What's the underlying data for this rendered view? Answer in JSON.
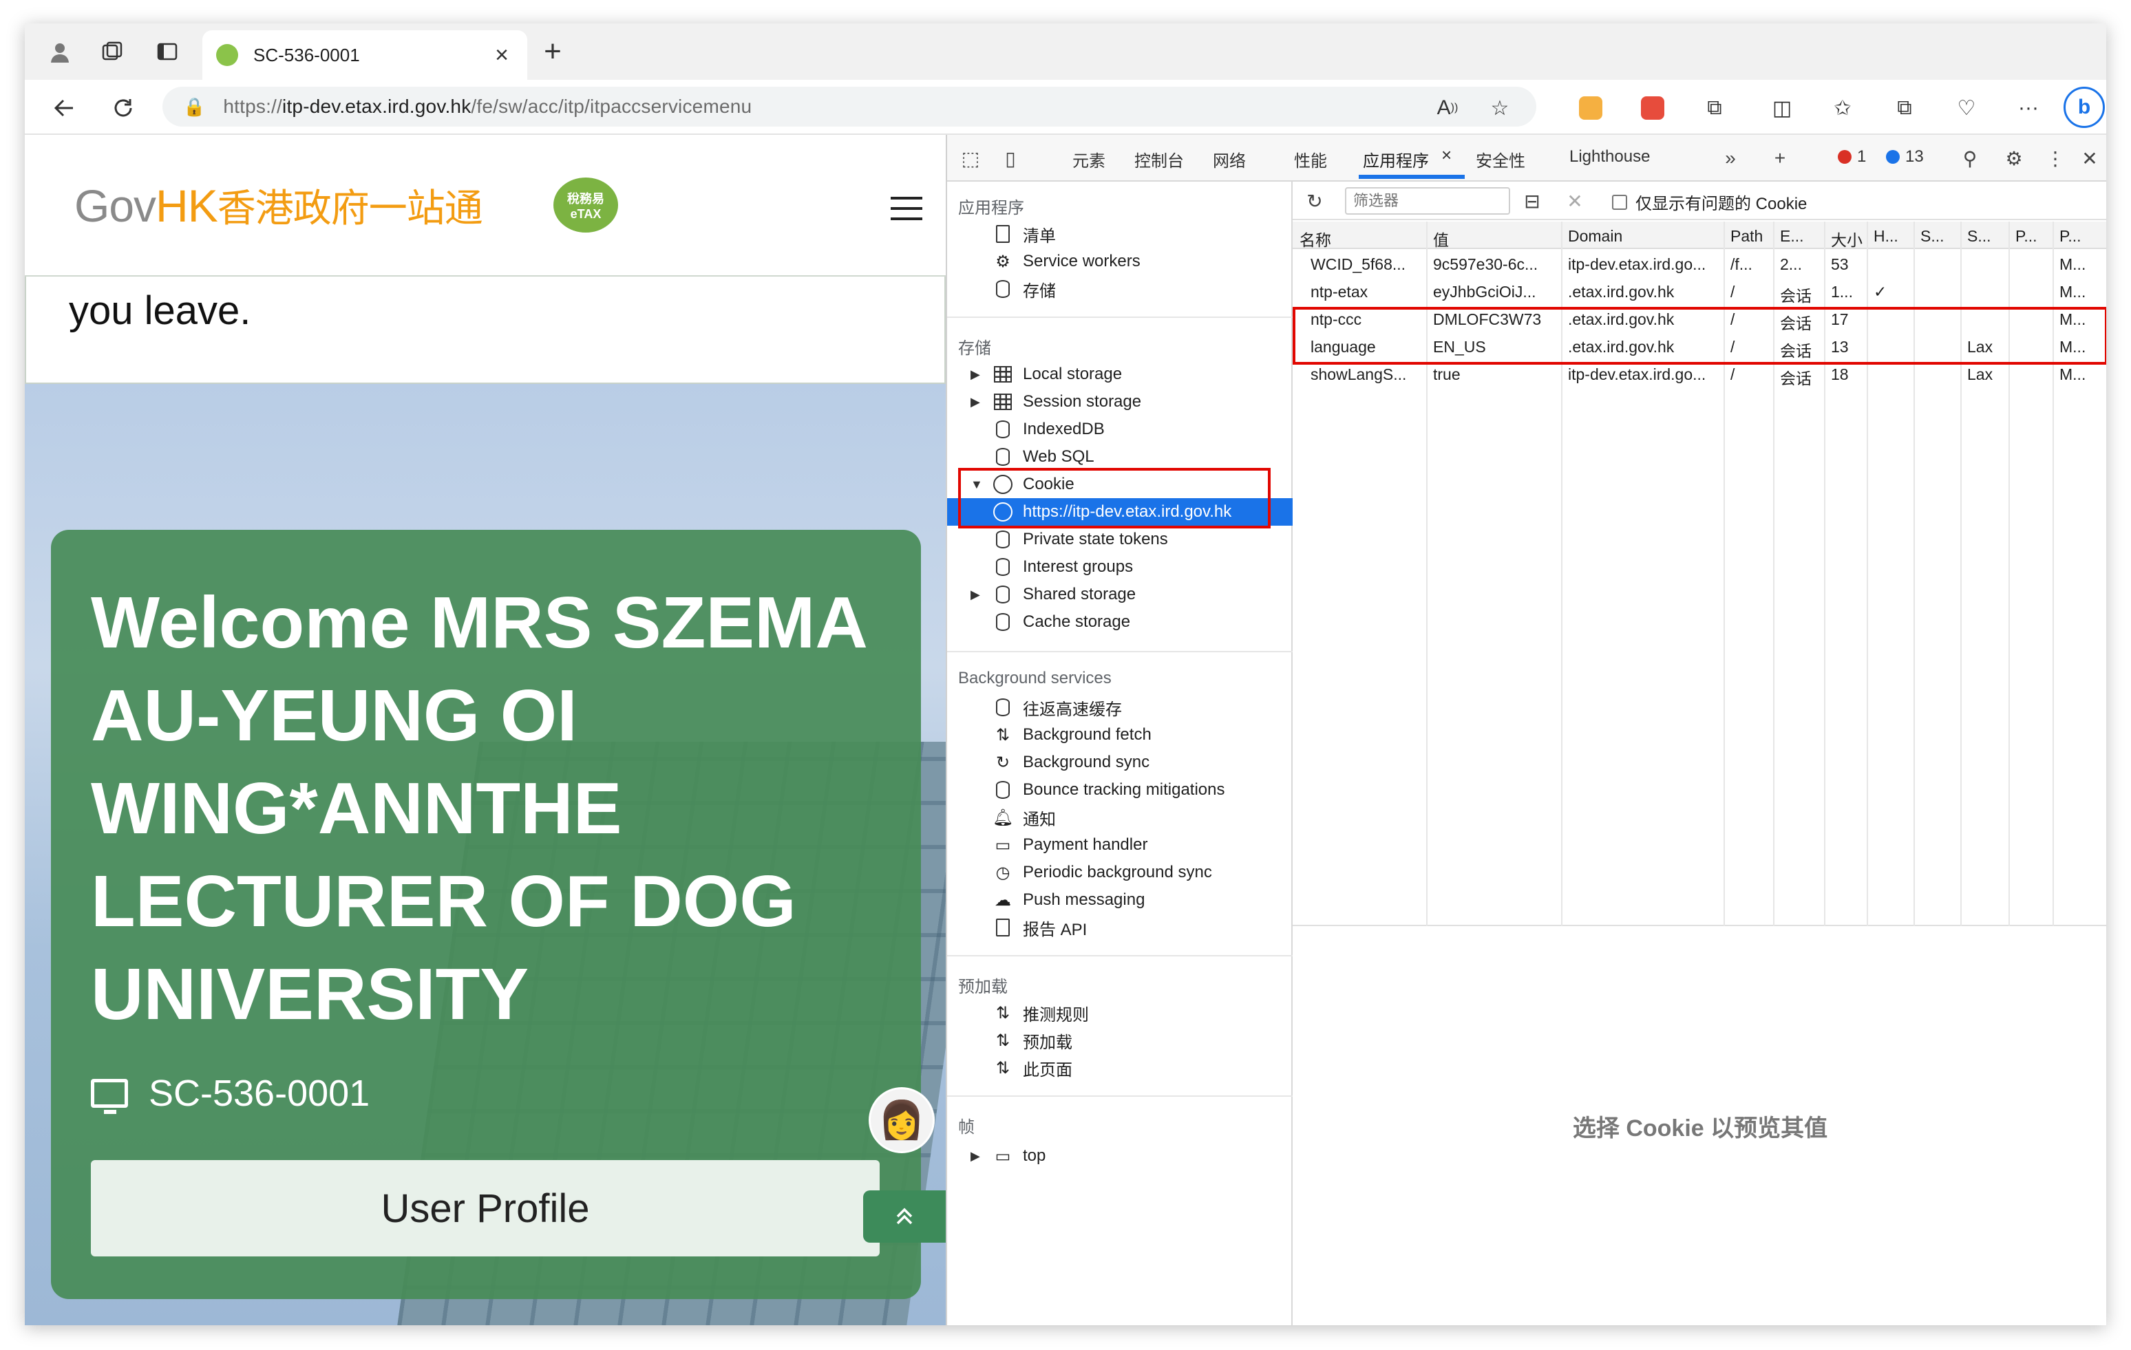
{
  "browser": {
    "tab_title": "SC-536-0001",
    "url_scheme": "https://",
    "url_host": "itp-dev.etax.ird.gov.hk",
    "url_path": "/fe/sw/acc/itp/itpaccservicemenu"
  },
  "site": {
    "logo_gov": "Gov",
    "logo_hk": "HK",
    "logo_zh": "香港政府一站通",
    "badge_line1": "稅務易",
    "badge_line2": "eTAX",
    "leave_text": "you leave.",
    "welcome": "Welcome MRS SZEMA AU-YEUNG OI WING*ANNTHE LECTURER OF DOG UNIVERSITY",
    "device_id": "SC-536-0001",
    "profile_button": "User Profile"
  },
  "devtools": {
    "tabs": [
      "元素",
      "控制台",
      "网络",
      "性能",
      "应用程序",
      "安全性",
      "Lighthouse"
    ],
    "error_count": "1",
    "message_count": "13",
    "sidebar": {
      "app_header": "应用程序",
      "app_items": [
        "清单",
        "Service workers",
        "存储"
      ],
      "storage_header": "存储",
      "storage_items": [
        "Local storage",
        "Session storage",
        "IndexedDB",
        "Web SQL",
        "Cookie"
      ],
      "cookie_origin": "https://itp-dev.etax.ird.gov.hk",
      "storage_items2": [
        "Private state tokens",
        "Interest groups",
        "Shared storage",
        "Cache storage"
      ],
      "bg_header": "Background services",
      "bg_items": [
        "往返高速缓存",
        "Background fetch",
        "Background sync",
        "Bounce tracking mitigations",
        "通知",
        "Payment handler",
        "Periodic background sync",
        "Push messaging",
        "报告 API"
      ],
      "preload_header": "预加载",
      "preload_items": [
        "推测规则",
        "预加载",
        "此页面"
      ],
      "frames_header": "帧",
      "frames_item": "top"
    },
    "toolbar": {
      "filter_placeholder": "筛选器",
      "only_issues": "仅显示有问题的 Cookie"
    },
    "columns": [
      "名称",
      "值",
      "Domain",
      "Path",
      "E...",
      "大小",
      "H...",
      "S...",
      "S...",
      "P...",
      "P..."
    ],
    "rows": [
      [
        "WCID_5f68...",
        "9c597e30-6c...",
        "itp-dev.etax.ird.go...",
        "/f...",
        "2...",
        "53",
        "",
        "",
        "",
        "",
        "M..."
      ],
      [
        "ntp-etax",
        "eyJhbGciOiJ...",
        ".etax.ird.gov.hk",
        "/",
        "会话",
        "1...",
        "✓",
        "",
        "",
        "",
        "M..."
      ],
      [
        "ntp-ccc",
        "DMLOFC3W73",
        ".etax.ird.gov.hk",
        "/",
        "会话",
        "17",
        "",
        "",
        "",
        "",
        "M..."
      ],
      [
        "language",
        "EN_US",
        ".etax.ird.gov.hk",
        "/",
        "会话",
        "13",
        "",
        "",
        "Lax",
        "",
        "M..."
      ],
      [
        "showLangS...",
        "true",
        "itp-dev.etax.ird.go...",
        "/",
        "会话",
        "18",
        "",
        "",
        "Lax",
        "",
        "M..."
      ]
    ],
    "preview_text": "选择 Cookie 以预览其值"
  },
  "colors": {
    "accent": "#1a73e8",
    "highlight_box": "#e10600",
    "card_green": "#488c58",
    "logo_orange": "#f39c12"
  }
}
